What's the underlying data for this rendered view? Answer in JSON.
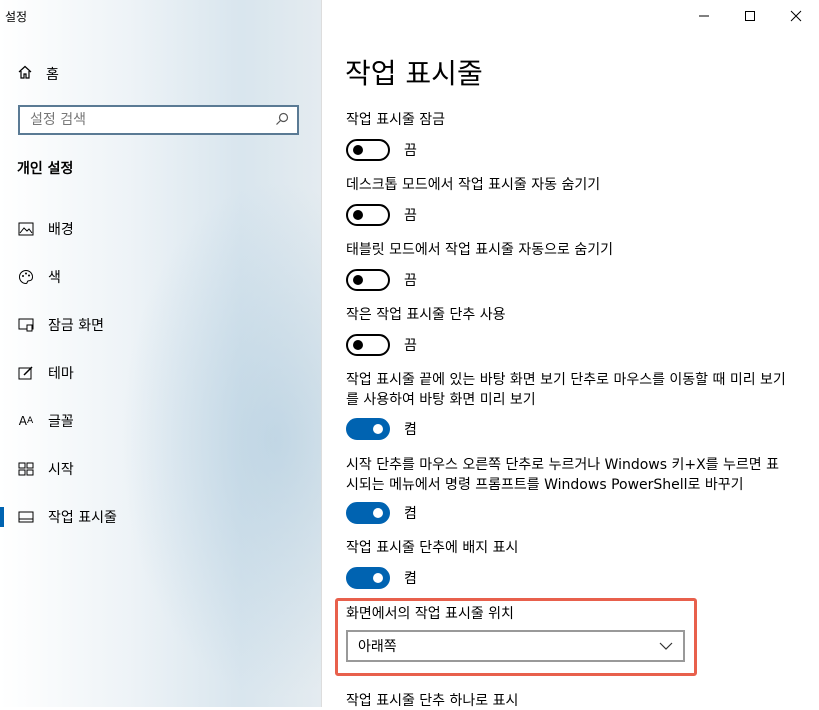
{
  "window": {
    "title": "설정",
    "controls": {
      "minimize": "—",
      "maximize": "☐",
      "close": "✕"
    }
  },
  "sidebar": {
    "home_label": "홈",
    "search_placeholder": "설정 검색",
    "section_header": "개인 설정",
    "items": [
      {
        "label": "배경",
        "icon": "image-icon"
      },
      {
        "label": "색",
        "icon": "palette-icon"
      },
      {
        "label": "잠금 화면",
        "icon": "lock-screen-icon"
      },
      {
        "label": "테마",
        "icon": "theme-icon"
      },
      {
        "label": "글꼴",
        "icon": "font-icon"
      },
      {
        "label": "시작",
        "icon": "start-icon"
      },
      {
        "label": "작업 표시줄",
        "icon": "taskbar-icon",
        "active": true
      }
    ]
  },
  "main": {
    "title": "작업 표시줄",
    "settings": [
      {
        "label": "작업 표시줄 잠금",
        "state": "끔"
      },
      {
        "label": "데스크톱 모드에서 작업 표시줄 자동 숨기기",
        "state": "끔"
      },
      {
        "label": "태블릿 모드에서 작업 표시줄 자동으로 숨기기",
        "state": "끔"
      },
      {
        "label": "작은 작업 표시줄 단추 사용",
        "state": "끔"
      },
      {
        "label": "작업 표시줄 끝에 있는 바탕 화면 보기 단추로 마우스를 이동할 때 미리 보기를 사용하여 바탕 화면 미리 보기",
        "state": "켬"
      },
      {
        "label": "시작 단추를 마우스 오른쪽 단추로 누르거나 Windows 키+X를 누르면 표시되는 메뉴에서 명령 프롬프트를 Windows PowerShell로 바꾸기",
        "state": "켬"
      },
      {
        "label": "작업 표시줄 단추에 배지 표시",
        "state": "켬"
      }
    ],
    "position": {
      "label": "화면에서의 작업 표시줄 위치",
      "value": "아래쪽"
    },
    "next_label": "작업 표시줄 단추 하나로 표시"
  },
  "colors": {
    "accent": "#0063b1",
    "highlight": "#e8604c"
  }
}
